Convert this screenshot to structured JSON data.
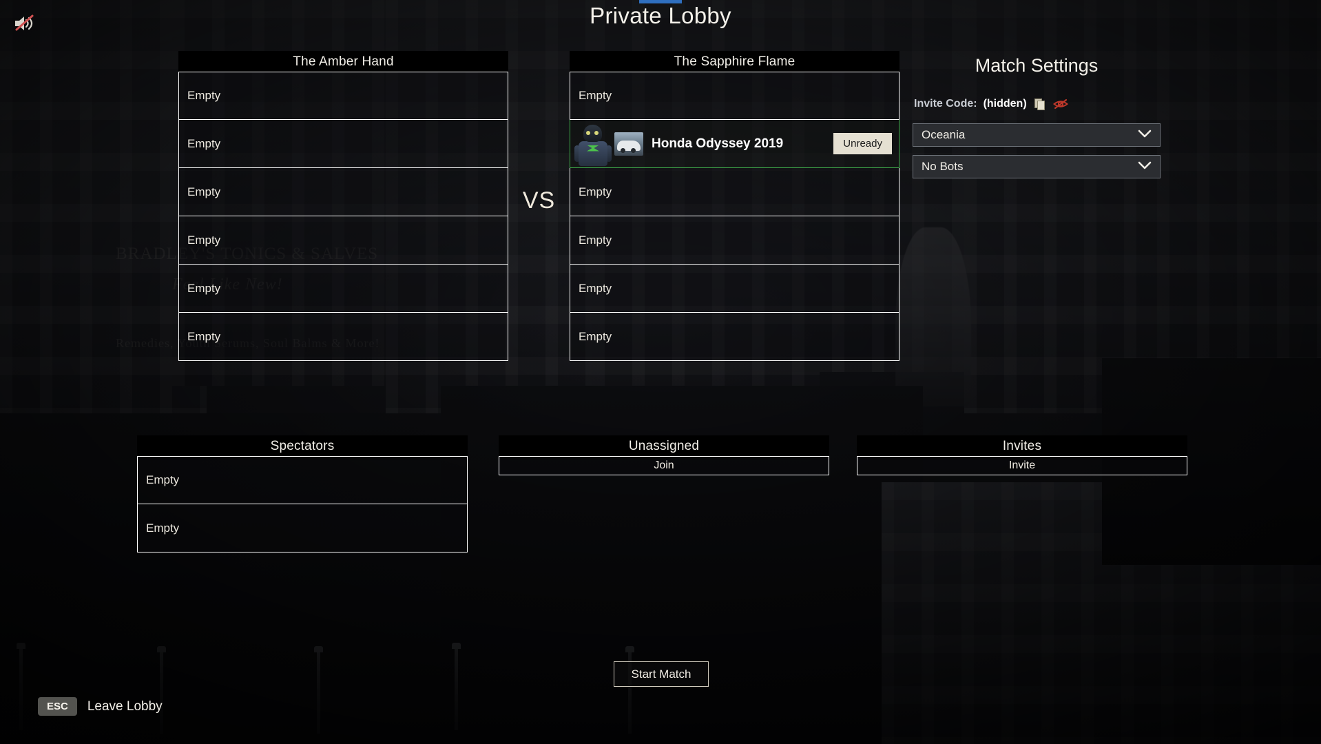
{
  "title": "Private Lobby",
  "mute_icon": "speaker-muted-icon",
  "teams": [
    {
      "name": "The Amber Hand",
      "slots": [
        {
          "type": "empty",
          "label": "Empty"
        },
        {
          "type": "empty",
          "label": "Empty"
        },
        {
          "type": "empty",
          "label": "Empty"
        },
        {
          "type": "empty",
          "label": "Empty"
        },
        {
          "type": "empty",
          "label": "Empty"
        },
        {
          "type": "empty",
          "label": "Empty"
        }
      ]
    },
    {
      "name": "The Sapphire Flame",
      "slots": [
        {
          "type": "empty",
          "label": "Empty"
        },
        {
          "type": "player",
          "label": "Honda Odyssey 2019",
          "ready_label": "Unready",
          "avatar": "player-avatar-icon",
          "thumbnail": "car-thumbnail-icon",
          "border_color": "#3faa4a"
        },
        {
          "type": "empty",
          "label": "Empty"
        },
        {
          "type": "empty",
          "label": "Empty"
        },
        {
          "type": "empty",
          "label": "Empty"
        },
        {
          "type": "empty",
          "label": "Empty"
        }
      ]
    }
  ],
  "vs_label": "VS",
  "match_settings": {
    "title": "Match Settings",
    "invite_code_label": "Invite Code:",
    "invite_code_value": "(hidden)",
    "copy_icon": "copy-icon",
    "reveal_icon": "eye-slash-icon",
    "dropdowns": [
      {
        "name": "region",
        "value": "Oceania",
        "chevron": "chevron-down-icon"
      },
      {
        "name": "bots",
        "value": "No Bots",
        "chevron": "chevron-down-icon"
      }
    ]
  },
  "spectators": {
    "title": "Spectators",
    "slots": [
      {
        "label": "Empty"
      },
      {
        "label": "Empty"
      }
    ]
  },
  "unassigned": {
    "title": "Unassigned",
    "action_label": "Join"
  },
  "invites": {
    "title": "Invites",
    "action_label": "Invite"
  },
  "footer": {
    "start_match_label": "Start Match",
    "esc_key_label": "ESC",
    "leave_lobby_label": "Leave Lobby"
  },
  "colors": {
    "ready_border": "#3faa4a",
    "title_accent": "#2f6fbf",
    "ready_button_bg": "#e5e0d2",
    "eye_slash": "#c0392b"
  },
  "background_signage": [
    "BRADLEY'S TONICS & SALVES",
    "Feel Like New!",
    "Remedies, Youth Serums, Soul Balms & More!"
  ]
}
